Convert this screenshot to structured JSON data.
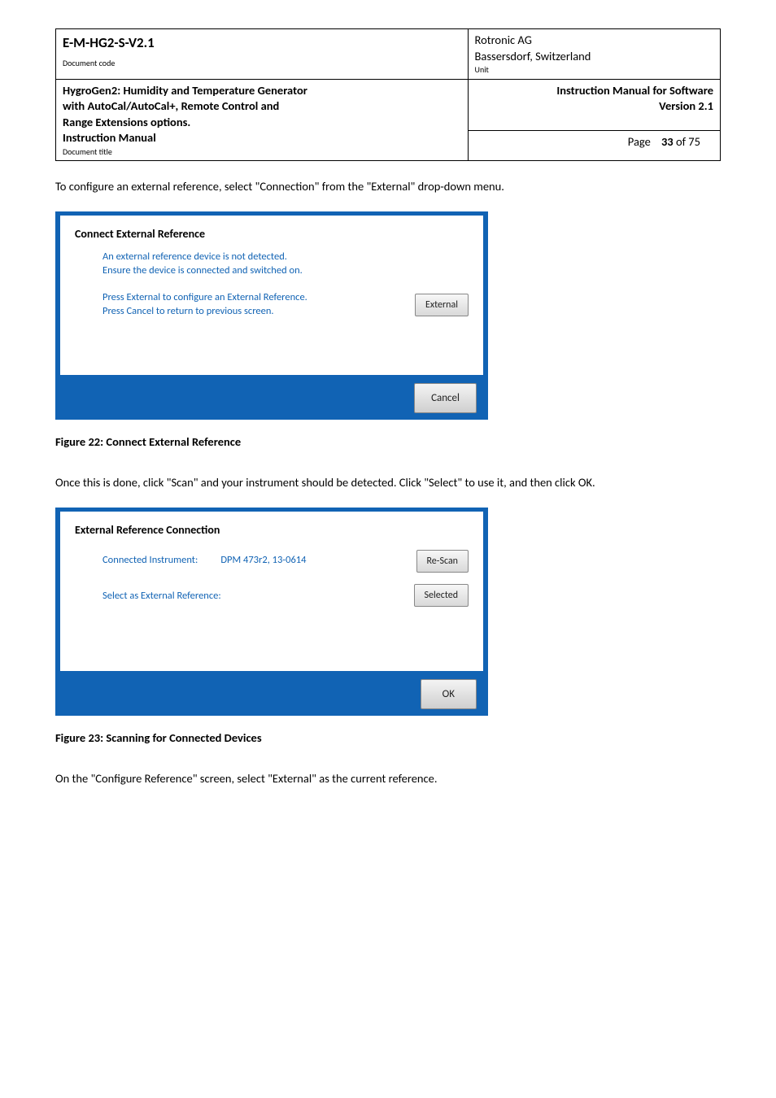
{
  "header": {
    "doc_code": "E-M-HG2-S-V2.1",
    "doc_code_label": "Document code",
    "company": "Rotronic AG",
    "location": "Bassersdorf, Switzerland",
    "unit_label": "Unit",
    "title_line1": "HygroGen2: Humidity and Temperature Generator",
    "title_line2": "with AutoCal/AutoCal+, Remote Control and",
    "title_line3": "Range Extensions options.",
    "title_line4": "Instruction Manual",
    "doc_title_label": "Document title",
    "manual_line1": "Instruction Manual for Software",
    "manual_line2": "Version 2.1",
    "page_label": "Page",
    "page_value": "33",
    "page_total": "of 75"
  },
  "para1": "To configure an external reference, select \"Connection\" from the \"External\" drop-down menu.",
  "dialog1": {
    "title": "Connect External Reference",
    "line1": "An external reference device is not detected.",
    "line2": "Ensure the device is connected and switched on.",
    "line3": "Press External to configure an External Reference.",
    "line4": "Press Cancel to return to previous screen.",
    "btn_external": "External",
    "btn_cancel": "Cancel"
  },
  "caption1": "Figure 22: Connect External Reference",
  "para2": "Once this is done, click \"Scan\" and your instrument should be detected. Click \"Select\" to use it, and then click OK.",
  "dialog2": {
    "title": "External Reference Connection",
    "row1_label": "Connected Instrument:",
    "row1_value": "DPM 473r2, 13-0614",
    "btn_rescan": "Re-Scan",
    "row2_label": "Select as External Reference:",
    "btn_selected": "Selected",
    "btn_ok": "OK"
  },
  "caption2": "Figure 23: Scanning for Connected Devices",
  "para3": "On the \"Configure Reference\" screen, select \"External\" as the current reference."
}
